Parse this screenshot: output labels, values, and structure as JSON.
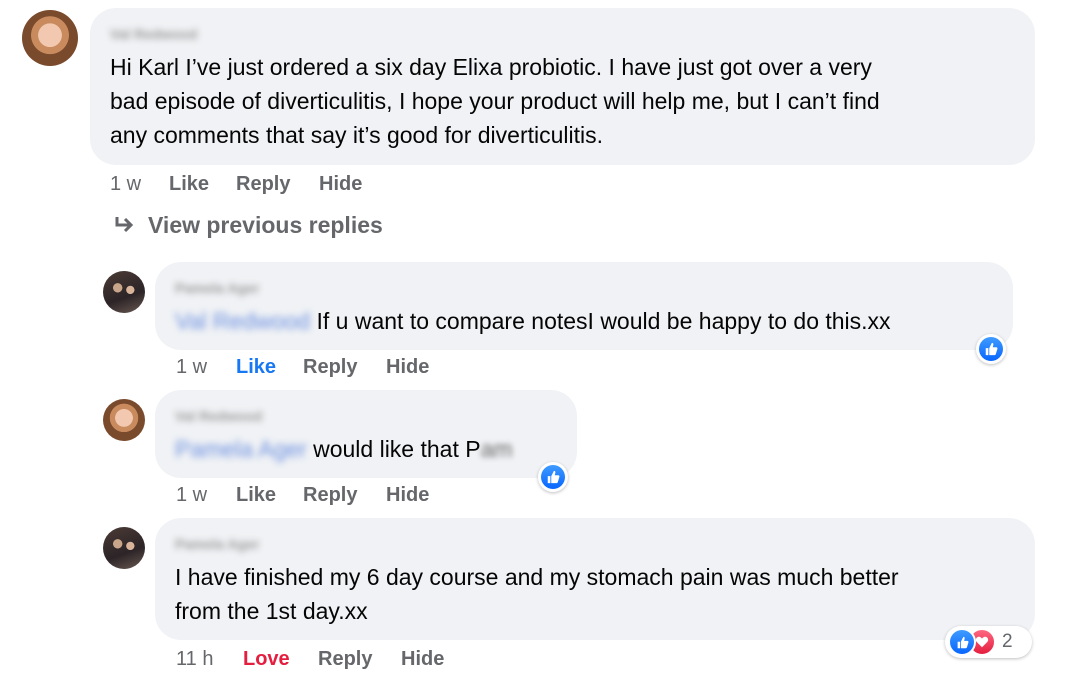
{
  "comments": [
    {
      "author": "Val Redwood",
      "text": "Hi Karl I’ve just ordered a six day Elixa probiotic. I have just got over a very bad episode of diverticulitis, I hope your product will help me, but I can’t find any comments that say it’s good for diverticulitis.",
      "lines": [
        "Hi Karl I’ve just ordered a six day Elixa probiotic. I have just got over a very",
        "bad episode of diverticulitis, I hope your product will help me, but I can’t find",
        "any comments that say it’s good for diverticulitis."
      ],
      "time": "1 w",
      "like": "Like",
      "reply": "Reply",
      "hide": "Hide"
    }
  ],
  "view_previous": "View previous replies",
  "replies": [
    {
      "author": "Pamela Ager",
      "mention": "Val Redwood",
      "text": "If u want to compare notesI would be happy to do this.xx",
      "time": "1 w",
      "like": "Like",
      "reply": "Reply",
      "hide": "Hide",
      "liked": true,
      "reaction": "like"
    },
    {
      "author": "Val Redwood",
      "mention": "Pamela Ager",
      "text": "would like that P",
      "text_tail": "am",
      "time": "1 w",
      "like": "Like",
      "reply": "Reply",
      "hide": "Hide",
      "reaction": "like"
    },
    {
      "author": "Pamela Ager",
      "lines": [
        "I have finished my 6 day course and my stomach pain was much better",
        "from the 1st day.xx"
      ],
      "time": "11 h",
      "like": "Love",
      "reply": "Reply",
      "hide": "Hide",
      "loved": true,
      "reactions": [
        "like",
        "love"
      ],
      "reaction_count": "2"
    }
  ],
  "colors": {
    "bubble": "#f0f2f5",
    "meta_text": "#65676b",
    "like_blue": "#1877f2",
    "love_red": "#e41e3f"
  }
}
